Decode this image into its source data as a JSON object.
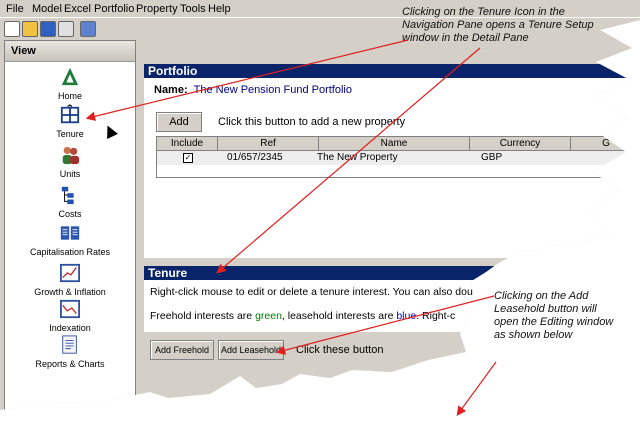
{
  "menu": [
    "File",
    "Model",
    "Excel",
    "Portfolio",
    "Property",
    "Tools",
    "Help"
  ],
  "toolbar_icons": [
    "new-icon",
    "open-icon",
    "save-icon",
    "print-icon",
    "report-icon"
  ],
  "nav": {
    "header": "View",
    "collapse": "»",
    "items": [
      {
        "label": "Home",
        "icon": "home-icon"
      },
      {
        "label": "Tenure",
        "icon": "tenure-icon"
      },
      {
        "label": "Units",
        "icon": "units-icon"
      },
      {
        "label": "Costs",
        "icon": "costs-icon"
      },
      {
        "label": "Capitalisation Rates",
        "icon": "capitalisation-rates-icon"
      },
      {
        "label": "Growth & Inflation",
        "icon": "growth-inflation-icon"
      },
      {
        "label": "Indexation",
        "icon": "indexation-icon"
      },
      {
        "label": "Reports & Charts",
        "icon": "reports-charts-icon"
      }
    ]
  },
  "portfolio": {
    "title": "Portfolio",
    "name_label": "Name:",
    "name_value": "The New Pension Fund Portfolio",
    "add_label": "Add",
    "add_hint": "Click this button to add a new property",
    "columns": [
      "Include",
      "Ref",
      "Name",
      "Currency",
      "G"
    ],
    "rows": [
      {
        "include": "✓",
        "ref": "01/657/2345",
        "name": "The New Property",
        "currency": "GBP"
      }
    ]
  },
  "tenure": {
    "title": "Tenure",
    "line1": "Right-click mouse to edit or delete a tenure interest.  You can also double-c",
    "line2_a": "Freehold interests are ",
    "line2_green": "green",
    "line2_b": ", leasehold interests are ",
    "line2_blue": "blue",
    "line2_c": ".  Right-c",
    "add_freehold": "Add Freehold",
    "add_leasehold": "Add Leasehold",
    "hint": "Click these button"
  },
  "callouts": {
    "top": "Clicking on the Tenure Icon in the Navigation Pane opens a Tenure Setup window in the Detail Pane",
    "right": "Clicking on the Add Leasehold button will open the Editing window as shown below"
  },
  "colors": {
    "titlebar": "#0a246a",
    "arrow": "#e02020",
    "window": "#d4d0c8"
  }
}
